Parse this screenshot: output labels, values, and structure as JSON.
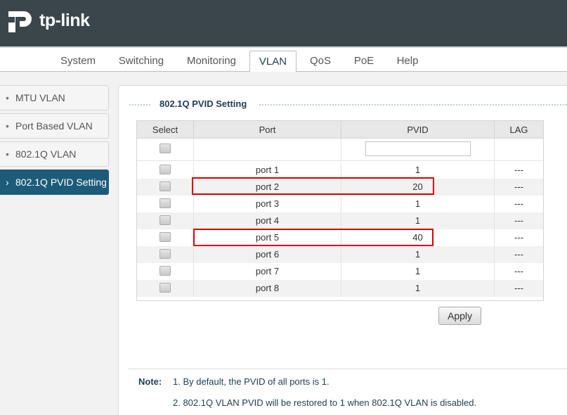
{
  "brand": {
    "logo_text": "tp-link",
    "header_color": "#3a464c"
  },
  "nav": {
    "tabs": [
      {
        "label": "System"
      },
      {
        "label": "Switching"
      },
      {
        "label": "Monitoring"
      },
      {
        "label": "VLAN",
        "active": true
      },
      {
        "label": "QoS"
      },
      {
        "label": "PoE"
      },
      {
        "label": "Help"
      }
    ]
  },
  "sidebar": {
    "items": [
      {
        "label": "MTU VLAN"
      },
      {
        "label": "Port Based VLAN"
      },
      {
        "label": "802.1Q VLAN"
      },
      {
        "label": "802.1Q PVID Setting",
        "active": true
      }
    ],
    "active_color": "#1d5b7b"
  },
  "section": {
    "title": "802.1Q PVID Setting"
  },
  "table": {
    "headers": {
      "select": "Select",
      "port": "Port",
      "pvid": "PVID",
      "lag": "LAG"
    },
    "filter": {
      "pvid_value": ""
    },
    "rows": [
      {
        "port": "port 1",
        "pvid": "1",
        "lag": "---"
      },
      {
        "port": "port 2",
        "pvid": "20",
        "lag": "---",
        "highlighted": true
      },
      {
        "port": "port 3",
        "pvid": "1",
        "lag": "---"
      },
      {
        "port": "port 4",
        "pvid": "1",
        "lag": "---"
      },
      {
        "port": "port 5",
        "pvid": "40",
        "lag": "---",
        "highlighted": true
      },
      {
        "port": "port 6",
        "pvid": "1",
        "lag": "---"
      },
      {
        "port": "port 7",
        "pvid": "1",
        "lag": "---"
      },
      {
        "port": "port 8",
        "pvid": "1",
        "lag": "---"
      }
    ],
    "highlight_color": "#e00000"
  },
  "apply_button": {
    "label": "Apply"
  },
  "note": {
    "label": "Note:",
    "lines": [
      "1. By default, the PVID of all ports is 1.",
      "2. 802.1Q VLAN PVID will be restored to 1 when 802.1Q VLAN is disabled."
    ]
  }
}
